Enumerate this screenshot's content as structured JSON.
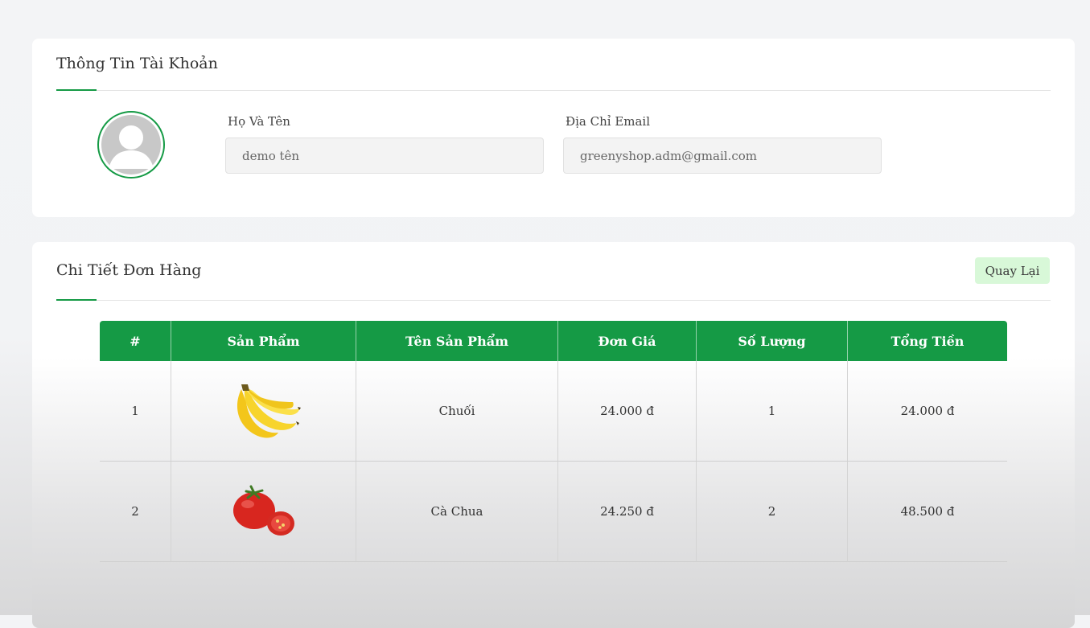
{
  "account": {
    "title": "Thông Tin Tài Khoản",
    "name_label": "Họ Và Tên",
    "name_value": "demo tên",
    "email_label": "Địa Chỉ Email",
    "email_value": "greenyshop.adm@gmail.com",
    "avatar_icon": "user-avatar-placeholder-icon"
  },
  "order": {
    "title": "Chi Tiết Đơn Hàng",
    "back_label": "Quay Lại",
    "columns": [
      "#",
      "Sản Phẩm",
      "Tên Sản Phẩm",
      "Đơn Giá",
      "Số Lượng",
      "Tổng Tiền"
    ],
    "rows": [
      {
        "index": "1",
        "image": "banana-image",
        "name": "Chuối",
        "price": "24.000 đ",
        "quantity": "1",
        "total": "24.000 đ"
      },
      {
        "index": "2",
        "image": "tomato-image",
        "name": "Cà Chua",
        "price": "24.250 đ",
        "quantity": "2",
        "total": "48.500 đ"
      }
    ]
  },
  "colors": {
    "accent": "#159a45",
    "back_button_bg": "#d8f8d8"
  }
}
